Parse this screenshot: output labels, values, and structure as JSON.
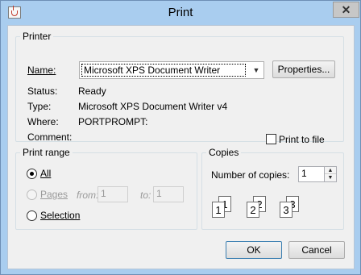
{
  "window": {
    "title": "Print"
  },
  "printer": {
    "legend": "Printer",
    "name_label": "Name:",
    "name_value": "Microsoft XPS Document Writer",
    "properties_label": "Properties...",
    "status_label": "Status:",
    "status_value": "Ready",
    "type_label": "Type:",
    "type_value": "Microsoft XPS Document Writer v4",
    "where_label": "Where:",
    "where_value": "PORTPROMPT:",
    "comment_label": "Comment:",
    "comment_value": "",
    "print_to_file_label": "Print to file",
    "print_to_file_checked": false
  },
  "print_range": {
    "legend": "Print range",
    "all_label": "All",
    "pages_label": "Pages",
    "from_label": "from:",
    "from_value": "1",
    "to_label": "to:",
    "to_value": "1",
    "selection_label": "Selection",
    "selected": "all"
  },
  "copies": {
    "legend": "Copies",
    "number_label": "Number of copies:",
    "number_value": "1",
    "collate_pages": [
      "1",
      "1",
      "2",
      "2",
      "3",
      "3"
    ]
  },
  "buttons": {
    "ok_label": "OK",
    "cancel_label": "Cancel"
  },
  "icons": {
    "app": "java-cup-icon",
    "close": "close-icon",
    "dropdown": "chevron-down-icon",
    "spin_up": "spin-up-icon",
    "spin_down": "spin-down-icon",
    "collate": "collate-pages-icon"
  },
  "colors": {
    "title_bar": "#a9cdef",
    "dialog_bg": "#f0f0f0",
    "primary_border": "#3c7fb1"
  }
}
